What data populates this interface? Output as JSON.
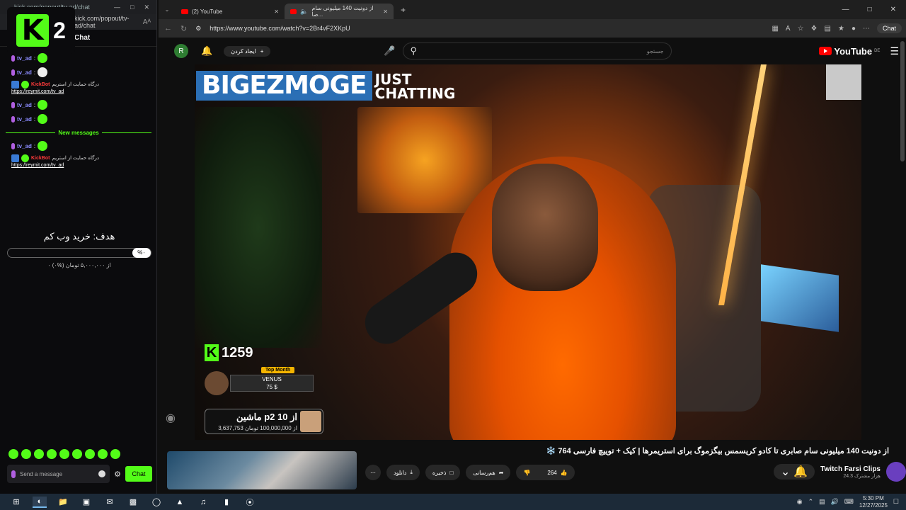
{
  "chat_window": {
    "url": "kick.com/popout/tv-ad/chat",
    "aa": "Aᴬ",
    "header": "Chat",
    "logo_digit": "2",
    "messages": [
      {
        "user": "tv_ad",
        "emote": "green"
      },
      {
        "user": "tv_ad",
        "emote": "skull"
      },
      {
        "type": "bot",
        "user": "KickBot",
        "text": "درگاه حمایت از استریم",
        "link": "https://reymit.com/tv_ad"
      },
      {
        "user": "tv_ad",
        "emote": "green"
      },
      {
        "user": "tv_ad",
        "emote": "green"
      }
    ],
    "new_messages_label": "New messages",
    "messages_after": [
      {
        "user": "tv_ad",
        "emote": "green"
      },
      {
        "type": "bot",
        "user": "KickBot",
        "text": "درگاه حمایت از استریم",
        "link": "https://reymit.com/tv_ad"
      }
    ],
    "goal": {
      "title": "هدف: خرید وب کم",
      "percent": "%۰",
      "progress": 0,
      "subtitle": "۰ از ۵,۰۰۰,۰۰۰ تومان (%۰)"
    },
    "input_placeholder": "Send a message",
    "send_label": "Chat"
  },
  "browser": {
    "tabs": [
      {
        "label": "(2) YouTube",
        "active": false
      },
      {
        "label": "از دونیت 140 میلیونی سام صا...",
        "active": true
      }
    ],
    "url": "https://www.youtube.com/watch?v=2Br4vF2XKpU",
    "copilot_label": "Chat"
  },
  "youtube": {
    "avatar_letter": "R",
    "create_label": "ایجاد کردن",
    "search_placeholder": "جستجو",
    "logo_text": "YouTube",
    "logo_region": "DE",
    "video": {
      "banner_name": "BIGEZMOGE",
      "banner_cat1": "JUST",
      "banner_cat2": "CHATTING",
      "viewer_count": "1259",
      "top_month_label": "Top Month",
      "top_donor": "VENUS",
      "top_amount": "75 $",
      "donate_title": "ماشین p2 از 10",
      "donate_sub": "3,637,753 از 100,000,000 تومان"
    },
    "title": "از دونیت 140 میلیونی سام صابری تا کادو کریسمس بیگزموگ برای استریمرها | کیک + توییچ فارسی 764 ❄️",
    "channel_name": "Twitch Farsi Clips",
    "subscribers": "24.3 هزار مشترک",
    "like_count": "264",
    "share_label": "هم‌رسانی",
    "save_label": "ذخیره",
    "download_label": "دانلود"
  },
  "taskbar": {
    "time": "5:30 PM",
    "date": "12/27/2025"
  }
}
